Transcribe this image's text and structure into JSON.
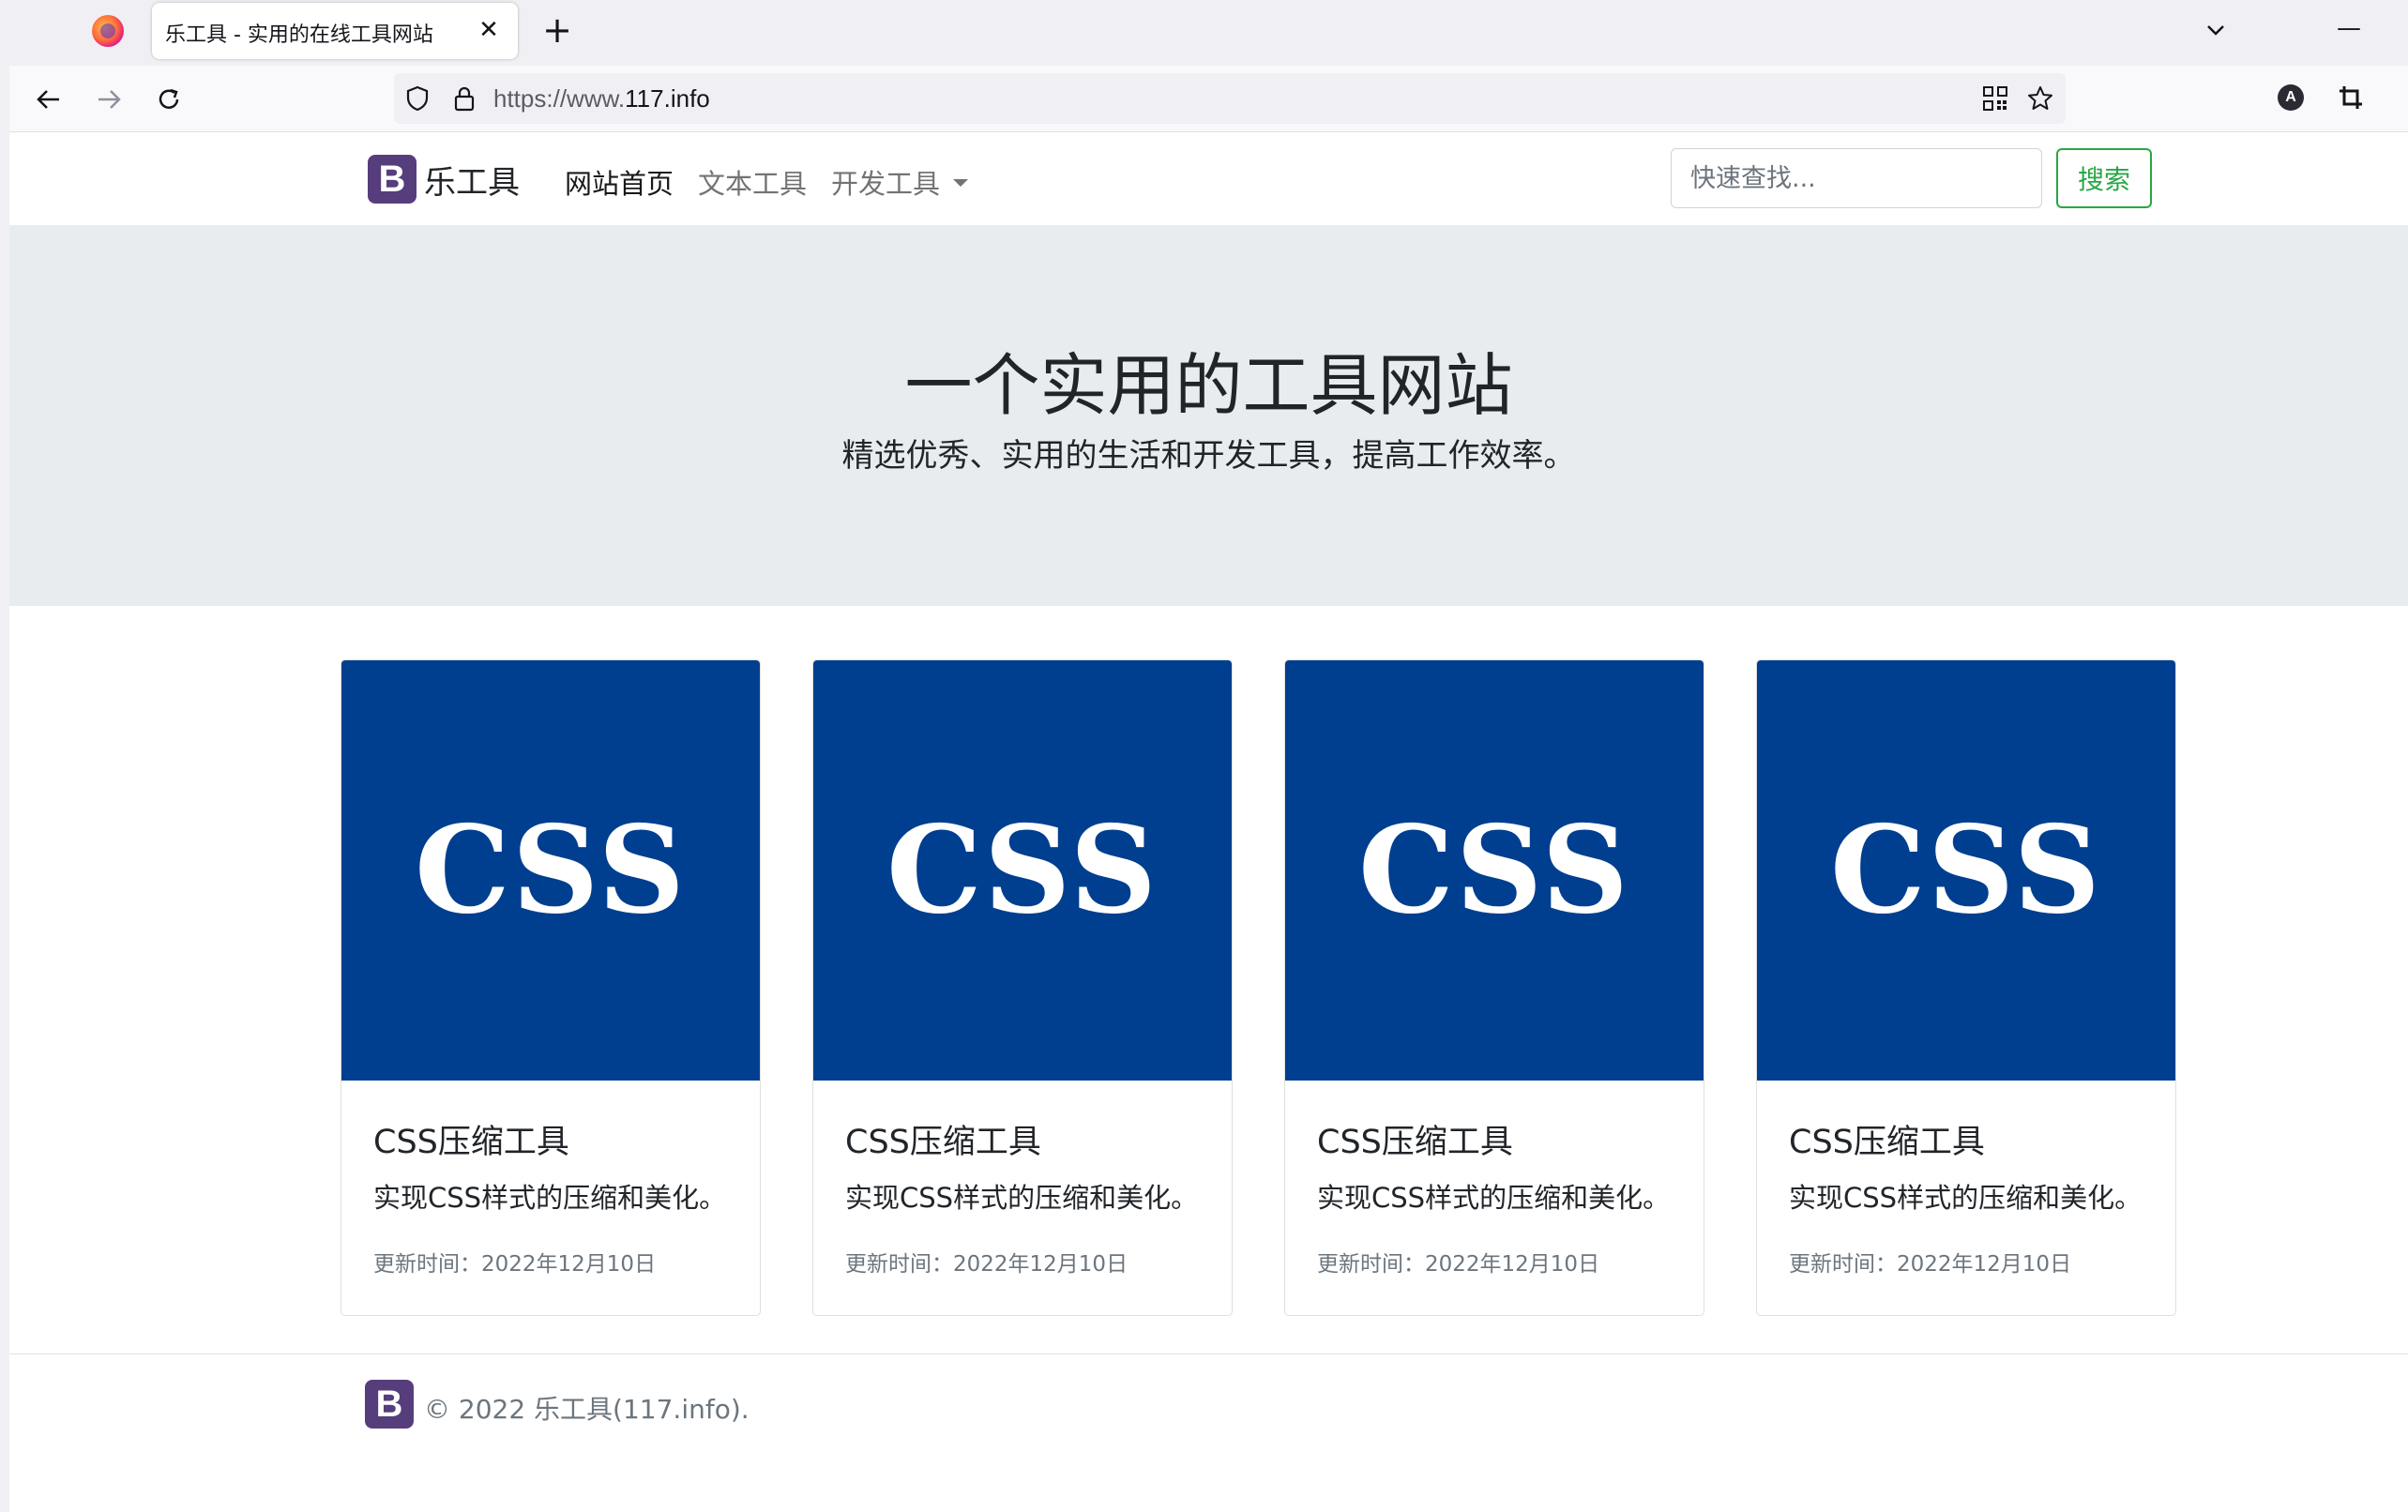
{
  "browser": {
    "tab_title": "乐工具 - 实用的在线工具网站",
    "url_prefix": "https://www.",
    "url_domain": "117.info",
    "tab_close_glyph": "✕",
    "new_tab_glyph": "+",
    "minimize_glyph": "—",
    "account_letter": "A"
  },
  "navbar": {
    "brand_logo": "B",
    "brand_name": "乐工具",
    "links": [
      {
        "label": "网站首页",
        "active": true
      },
      {
        "label": "文本工具",
        "active": false
      },
      {
        "label": "开发工具",
        "active": false,
        "dropdown": true
      }
    ],
    "search_placeholder": "快速查找...",
    "search_button": "搜索"
  },
  "hero": {
    "title": "一个实用的工具网站",
    "subtitle": "精选优秀、实用的生活和开发工具，提高工作效率。"
  },
  "cards": [
    {
      "image_text": "CSS",
      "title": "CSS压缩工具",
      "description": "实现CSS样式的压缩和美化。",
      "meta": "更新时间：2022年12月10日"
    },
    {
      "image_text": "CSS",
      "title": "CSS压缩工具",
      "description": "实现CSS样式的压缩和美化。",
      "meta": "更新时间：2022年12月10日"
    },
    {
      "image_text": "CSS",
      "title": "CSS压缩工具",
      "description": "实现CSS样式的压缩和美化。",
      "meta": "更新时间：2022年12月10日"
    },
    {
      "image_text": "CSS",
      "title": "CSS压缩工具",
      "description": "实现CSS样式的压缩和美化。",
      "meta": "更新时间：2022年12月10日"
    }
  ],
  "footer": {
    "logo": "B",
    "text": "© 2022 乐工具(117.info)."
  },
  "colors": {
    "brand": "#563d7c",
    "card_image_bg": "#003f8f",
    "search_button": "#28a745",
    "jumbotron_bg": "#e9ecef"
  }
}
